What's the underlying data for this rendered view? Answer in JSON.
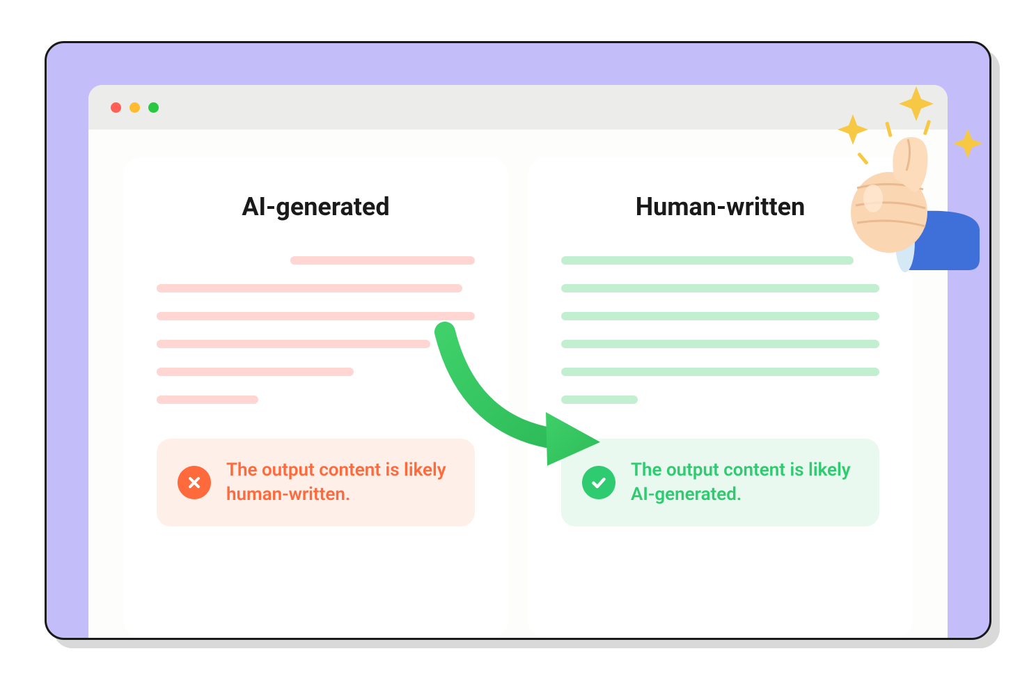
{
  "left": {
    "title": "AI-generated",
    "status": "The output content is likely human-written."
  },
  "right": {
    "title": "Human-written",
    "status": "The output content is likely AI-generated."
  }
}
